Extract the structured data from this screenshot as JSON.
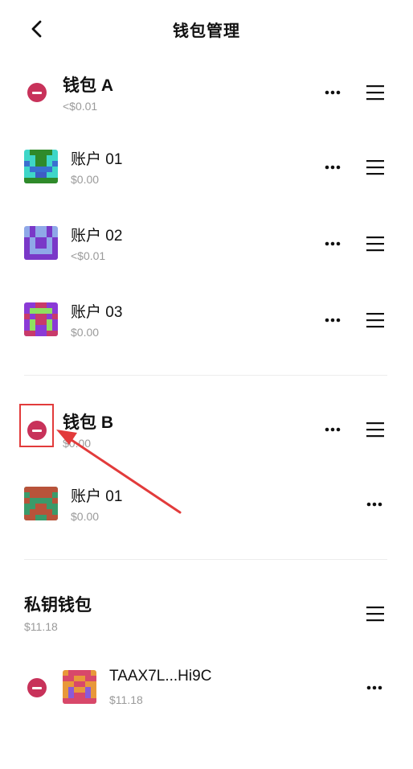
{
  "header": {
    "title": "钱包管理",
    "back_icon": "chevron-left-icon"
  },
  "wallets": [
    {
      "name": "钱包 A",
      "amount": "<$0.01",
      "accounts": [
        {
          "name": "账户 01",
          "amount": "$0.00"
        },
        {
          "name": "账户 02",
          "amount": "<$0.01"
        },
        {
          "name": "账户 03",
          "amount": "$0.00"
        }
      ]
    },
    {
      "name": "钱包 B",
      "amount": "$0.00",
      "accounts": [
        {
          "name": "账户 01",
          "amount": "$0.00"
        }
      ]
    }
  ],
  "private_key_wallet": {
    "name": "私钥钱包",
    "amount": "$11.18",
    "accounts": [
      {
        "name": "TAAX7L...Hi9C",
        "amount": "$11.18"
      }
    ]
  },
  "colors": {
    "remove": "#c8325a",
    "annotation": "#e23b3b",
    "secondary_text": "#9a9a9a"
  }
}
